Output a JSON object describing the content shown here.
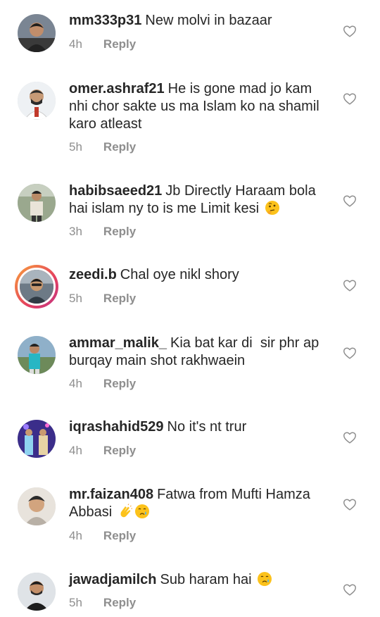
{
  "icons": {
    "like": "heart-outline-icon"
  },
  "comments": [
    {
      "username": "mm333p31",
      "text": "New molvi in bazaar",
      "time": "4h",
      "reply": "Reply"
    },
    {
      "username": "omer.ashraf21",
      "text": "He is gone mad jo kam nhi chor sakte us ma Islam ko na shamil karo atleast",
      "time": "5h",
      "reply": "Reply"
    },
    {
      "username": "habibsaeed21",
      "text": "Jb Directly Haraam bola hai islam ny to is me Limit kesi",
      "time": "3h",
      "reply": "Reply"
    },
    {
      "username": "zeedi.b",
      "text": "Chal oye nikl shory",
      "time": "5h",
      "reply": "Reply"
    },
    {
      "username": "ammar_malik_",
      "text": "Kia bat kar di  sir phr ap burqay main shot rakhwaein",
      "time": "4h",
      "reply": "Reply"
    },
    {
      "username": "iqrashahid529",
      "text": "No it's nt trur",
      "time": "4h",
      "reply": "Reply"
    },
    {
      "username": "mr.faizan408",
      "text": "Fatwa from Mufti Hamza Abbasi",
      "time": "4h",
      "reply": "Reply"
    },
    {
      "username": "jawadjamilch",
      "text": "Sub haram hai",
      "time": "5h",
      "reply": "Reply"
    }
  ]
}
